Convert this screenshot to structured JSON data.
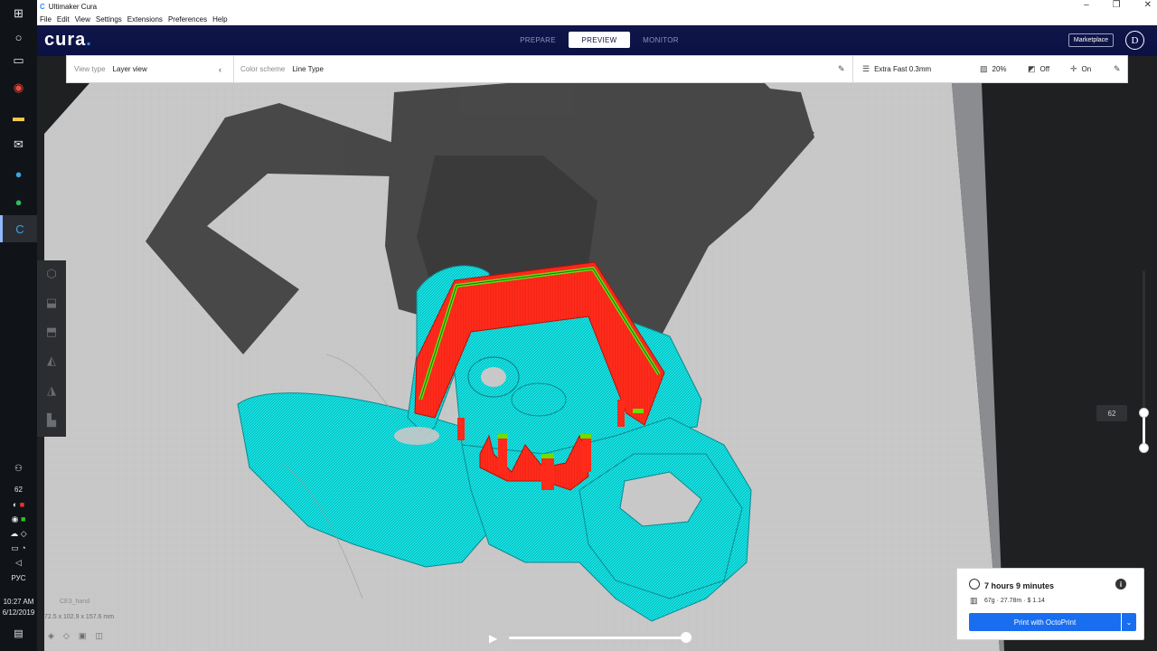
{
  "window": {
    "title": "Ultimaker Cura",
    "menu": [
      "File",
      "Edit",
      "View",
      "Settings",
      "Extensions",
      "Preferences",
      "Help"
    ]
  },
  "header": {
    "logo": "cura",
    "tabs": [
      {
        "label": "PREPARE",
        "active": false
      },
      {
        "label": "PREVIEW",
        "active": true
      },
      {
        "label": "MONITOR",
        "active": false
      }
    ],
    "marketplace": "Marketplace",
    "user_initial": "D"
  },
  "toolbar": {
    "view_type_label": "View type",
    "view_type_value": "Layer view",
    "color_scheme_label": "Color scheme",
    "color_scheme_value": "Line Type",
    "profile": "Extra Fast 0.3mm",
    "infill": "20%",
    "support": "Off",
    "adhesion": "On"
  },
  "layer_slider": {
    "value": "62"
  },
  "object": {
    "name": "CE3_hand",
    "dimensions": "72.5 x 102.9 x 157.6 mm"
  },
  "print": {
    "time": "7 hours 9 minutes",
    "material": "67g · 27.78m · $ 1.14",
    "button": "Print with OctoPrint"
  },
  "taskbar": {
    "tray_value": "62",
    "language": "РУС",
    "time": "10:27 AM",
    "date": "6/12/2019"
  },
  "colors": {
    "header": "#0d1242",
    "accent": "#196ef0",
    "wall_outer": "#ff2a1a",
    "skin": "#00e0e0",
    "wall_inner": "#6adf00",
    "shadow_model": "#3b3b3b"
  }
}
